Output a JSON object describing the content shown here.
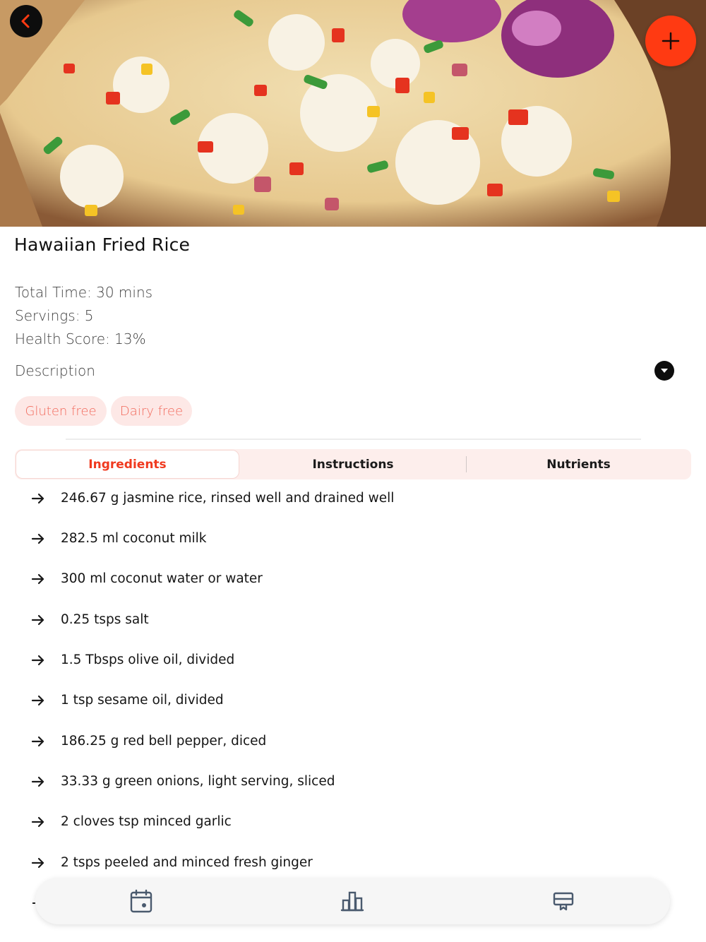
{
  "hero": {
    "image_alt": "Hawaiian Fried Rice dish"
  },
  "recipe": {
    "title": "Hawaiian Fried Rice",
    "total_time": "Total Time: 30 mins",
    "servings": "Servings: 5",
    "health_score": "Health Score: 13%",
    "description_label": "Description",
    "tags": [
      "Gluten free",
      "Dairy free"
    ]
  },
  "tabs": [
    {
      "label": "Ingredients",
      "active": true
    },
    {
      "label": "Instructions",
      "active": false
    },
    {
      "label": "Nutrients",
      "active": false
    }
  ],
  "ingredients": [
    "246.67 g jasmine rice, rinsed well and drained well",
    "282.5 ml coconut milk",
    "300 ml coconut water or water",
    "0.25 tsps salt",
    "1.5 Tbsps olive oil, divided",
    "1 tsp sesame oil, divided",
    "186.25 g red bell pepper, diced",
    "33.33 g green onions, light serving, sliced",
    "2 cloves tsp minced garlic",
    "2 tsps peeled and minced fresh ginger"
  ],
  "icons": {
    "back": "chevron-left-icon",
    "add": "plus-icon",
    "description_toggle": "chevron-down-icon",
    "ingredient_bullet": "arrow-right-icon",
    "nav": [
      "calendar-icon",
      "chart-icon",
      "recipe-box-icon"
    ]
  },
  "colors": {
    "accent": "#ff3a12",
    "tab_active_text": "#f03a1f",
    "chip_bg": "#fde8e6",
    "chip_text": "#f26a5c",
    "tab_bg": "#fdeeec"
  }
}
